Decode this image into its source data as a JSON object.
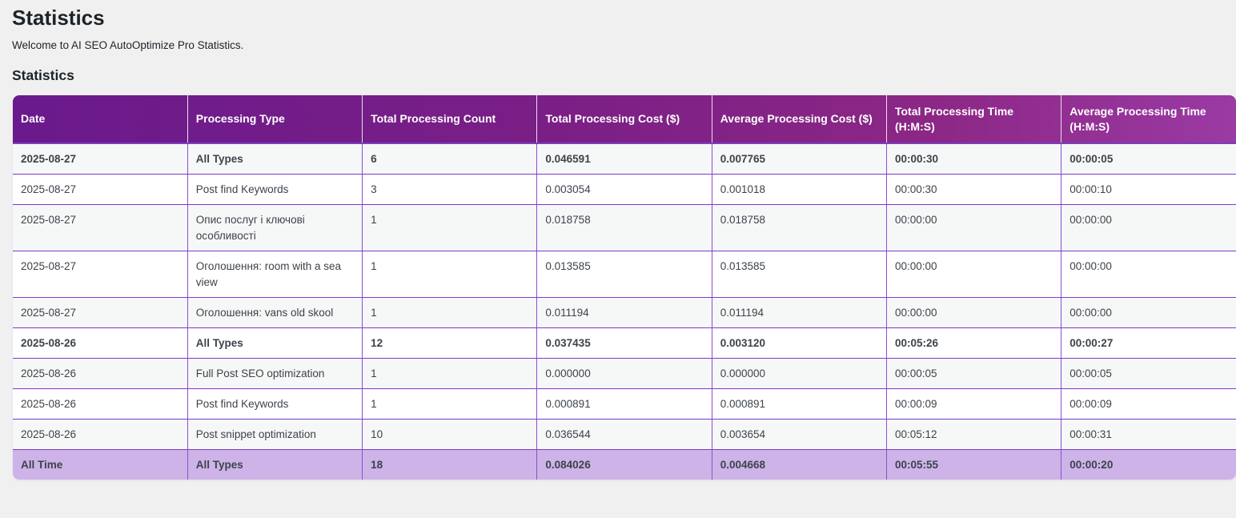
{
  "page": {
    "title": "Statistics",
    "intro": "Welcome to AI SEO AutoOptimize Pro Statistics.",
    "section_title": "Statistics"
  },
  "table": {
    "headers": [
      "Date",
      "Processing Type",
      "Total Processing Count",
      "Total Processing Cost ($)",
      "Average Processing Cost ($)",
      "Total Processing Time (H:M:S)",
      "Average Processing Time (H:M:S)"
    ],
    "rows": [
      {
        "kind": "total",
        "cells": [
          "2025-08-27",
          "All Types",
          "6",
          "0.046591",
          "0.007765",
          "00:00:30",
          "00:00:05"
        ]
      },
      {
        "kind": "normal",
        "cells": [
          "2025-08-27",
          "Post find Keywords",
          "3",
          "0.003054",
          "0.001018",
          "00:00:30",
          "00:00:10"
        ]
      },
      {
        "kind": "normal",
        "cells": [
          "2025-08-27",
          "Опис послуг і ключові особливості",
          "1",
          "0.018758",
          "0.018758",
          "00:00:00",
          "00:00:00"
        ]
      },
      {
        "kind": "normal",
        "cells": [
          "2025-08-27",
          "Оголошення: room with a sea view",
          "1",
          "0.013585",
          "0.013585",
          "00:00:00",
          "00:00:00"
        ]
      },
      {
        "kind": "normal",
        "cells": [
          "2025-08-27",
          "Оголошення: vans old skool",
          "1",
          "0.011194",
          "0.011194",
          "00:00:00",
          "00:00:00"
        ]
      },
      {
        "kind": "total",
        "cells": [
          "2025-08-26",
          "All Types",
          "12",
          "0.037435",
          "0.003120",
          "00:05:26",
          "00:00:27"
        ]
      },
      {
        "kind": "normal",
        "cells": [
          "2025-08-26",
          "Full Post SEO optimization",
          "1",
          "0.000000",
          "0.000000",
          "00:00:05",
          "00:00:05"
        ]
      },
      {
        "kind": "normal",
        "cells": [
          "2025-08-26",
          "Post find Keywords",
          "1",
          "0.000891",
          "0.000891",
          "00:00:09",
          "00:00:09"
        ]
      },
      {
        "kind": "normal",
        "cells": [
          "2025-08-26",
          "Post snippet optimization",
          "10",
          "0.036544",
          "0.003654",
          "00:05:12",
          "00:00:31"
        ]
      },
      {
        "kind": "alltime",
        "cells": [
          "All Time",
          "All Types",
          "18",
          "0.084026",
          "0.004668",
          "00:05:55",
          "00:00:20"
        ]
      }
    ]
  },
  "colors": {
    "header_gradient_start": "#6a1a8c",
    "header_gradient_end": "#9a3aa3",
    "row_border": "#7d3bc8",
    "alltime_row_bg": "#cdb3e8",
    "page_bg": "#f0f0f1"
  }
}
